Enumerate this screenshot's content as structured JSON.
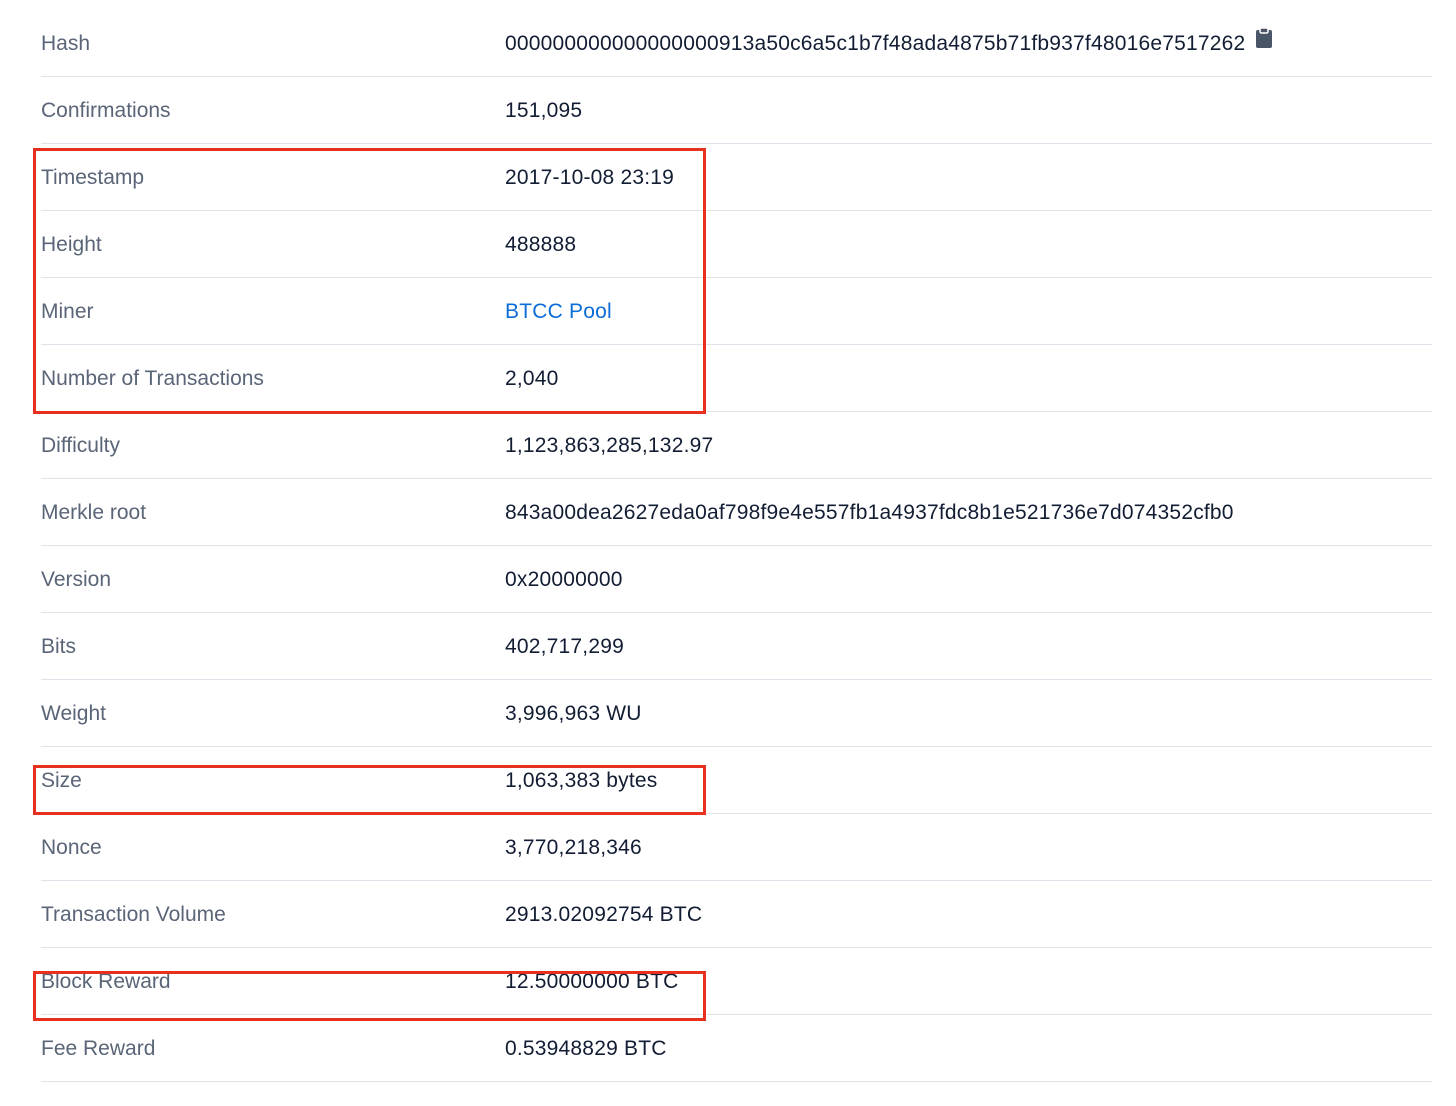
{
  "rows": [
    {
      "label": "Hash",
      "value": "000000000000000000913a50c6a5c1b7f48ada4875b71fb937f48016e7517262"
    },
    {
      "label": "Confirmations",
      "value": "151,095"
    },
    {
      "label": "Timestamp",
      "value": "2017-10-08 23:19"
    },
    {
      "label": "Height",
      "value": "488888"
    },
    {
      "label": "Miner",
      "value": "BTCC Pool"
    },
    {
      "label": "Number of Transactions",
      "value": "2,040"
    },
    {
      "label": "Difficulty",
      "value": "1,123,863,285,132.97"
    },
    {
      "label": "Merkle root",
      "value": "843a00dea2627eda0af798f9e4e557fb1a4937fdc8b1e521736e7d074352cfb0"
    },
    {
      "label": "Version",
      "value": "0x20000000"
    },
    {
      "label": "Bits",
      "value": "402,717,299"
    },
    {
      "label": "Weight",
      "value": "3,996,963 WU"
    },
    {
      "label": "Size",
      "value": "1,063,383 bytes"
    },
    {
      "label": "Nonce",
      "value": "3,770,218,346"
    },
    {
      "label": "Transaction Volume",
      "value": "2913.02092754 BTC"
    },
    {
      "label": "Block Reward",
      "value": "12.50000000 BTC"
    },
    {
      "label": "Fee Reward",
      "value": "0.53948829 BTC"
    }
  ],
  "icons": {
    "copy": "clipboard-icon"
  },
  "colors": {
    "label": "#5a6577",
    "value": "#121d33",
    "link": "#0c6cd8",
    "divider": "#dfe3ea",
    "highlight": "#e8301f"
  }
}
